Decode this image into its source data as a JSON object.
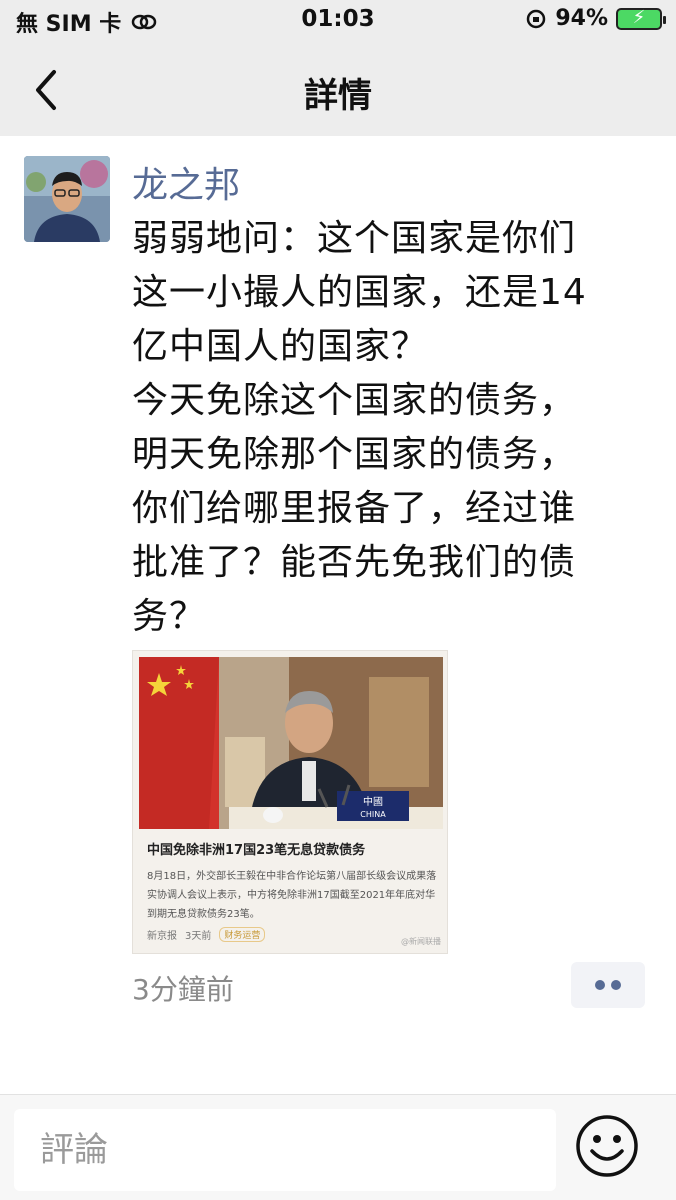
{
  "status_bar": {
    "carrier": "無 SIM 卡",
    "time": "01:03",
    "battery": "94%"
  },
  "nav": {
    "title": "詳情"
  },
  "post": {
    "author": "龙之邦",
    "text": "弱弱地问：这个国家是你们\n这一小撮人的国家，还是14\n亿中国人的国家？\n今天免除这个国家的债务，\n明天免除那个国家的债务，\n你们给哪里报备了，经过谁\n批准了？能否先免我们的债\n务？",
    "timestamp": "3分鐘前"
  },
  "news_card": {
    "nameplate": "中國",
    "nameplate_en": "CHINA",
    "headline": "中国免除非洲17国23笔无息贷款债务",
    "body": "8月18日，外交部长王毅在中非合作论坛第八届部长级会议成果落实协调人会议上表示，中方将免除非洲17国截至2021年年底对华到期无息贷款债务23笔。",
    "source": "新京报",
    "time": "3天前",
    "tag": "财务运营",
    "watermark": "@新闻联播"
  },
  "comment_bar": {
    "placeholder": "評論"
  },
  "colors": {
    "link": "#576b95",
    "bar_bg": "#ededed"
  }
}
